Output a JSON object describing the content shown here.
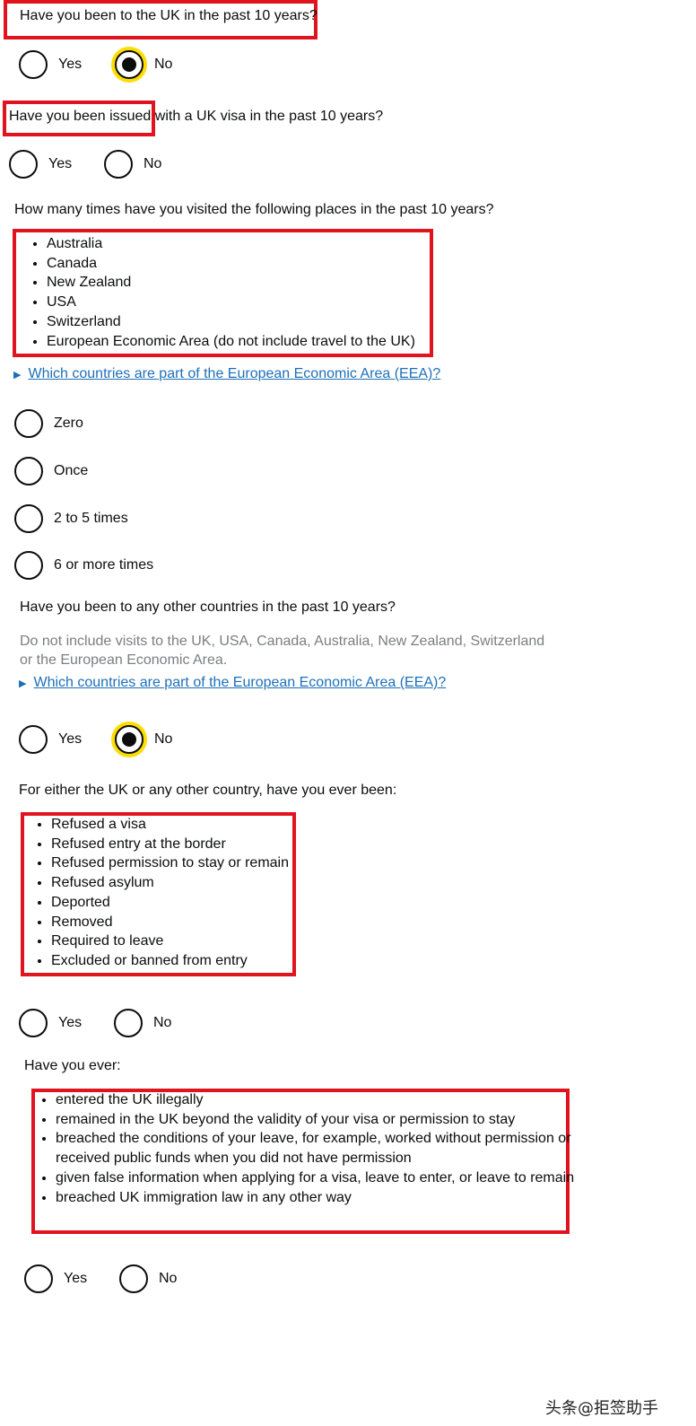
{
  "q1": {
    "text": "Have you been to the UK in the past 10 years?",
    "options": [
      "Yes",
      "No"
    ],
    "selected": "No"
  },
  "q2": {
    "text": "Have you been issued with a UK visa in the past 10 years?",
    "options": [
      "Yes",
      "No"
    ]
  },
  "q3": {
    "text": "How many times have you visited the following places in the past 10 years?",
    "places": [
      "Australia",
      "Canada",
      "New Zealand",
      "USA",
      "Switzerland",
      "European Economic Area (do not include travel to the UK)"
    ],
    "details_link": "Which countries are part of the European Economic Area (EEA)?",
    "options": [
      "Zero",
      "Once",
      "2 to 5 times",
      "6 or more times"
    ]
  },
  "q4": {
    "text": "Have you been to any other countries in the past 10 years?",
    "hint_line1": "Do not include visits to the UK, USA, Canada, Australia, New Zealand, Switzerland",
    "hint_line2": "or the European Economic Area.",
    "details_link": "Which countries are part of the European Economic Area (EEA)?",
    "options": [
      "Yes",
      "No"
    ],
    "selected": "No"
  },
  "q5": {
    "text": "For either the UK or any other country, have you ever been:",
    "items": [
      "Refused a visa",
      "Refused entry at the border",
      "Refused permission to stay or remain",
      "Refused asylum",
      "Deported",
      "Removed",
      "Required to leave",
      "Excluded or banned from entry"
    ],
    "options": [
      "Yes",
      "No"
    ]
  },
  "q6": {
    "text": "Have you ever:",
    "items": [
      "entered the UK illegally",
      "remained in the UK beyond the validity of your visa or permission to stay",
      "breached the conditions of your leave, for example, worked without permission or received public funds when you did not have permission",
      "given false information when applying for a visa, leave to enter, or leave to remain",
      "breached UK immigration law in any other way"
    ],
    "options": [
      "Yes",
      "No"
    ]
  },
  "watermark": "头条@拒签助手",
  "colors": {
    "highlight": "#e0141e",
    "focus": "#ffdd00",
    "link": "#1d70b8",
    "hint": "#7a7f82"
  }
}
